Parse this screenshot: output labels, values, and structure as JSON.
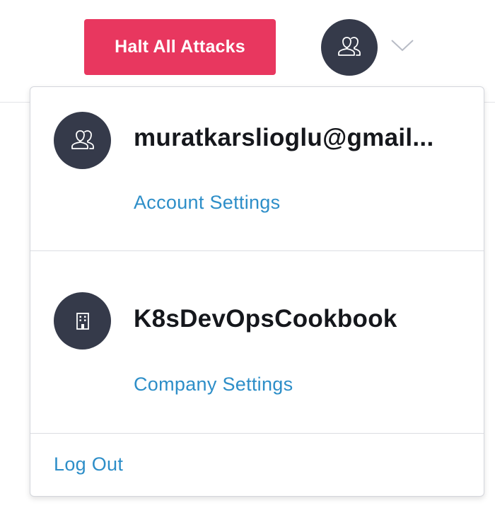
{
  "header": {
    "halt_button_label": "Halt All Attacks",
    "avatar_icon": "user-group-icon",
    "menu_toggle_icon": "chevron-down-icon"
  },
  "dropdown": {
    "account": {
      "icon": "user-group-icon",
      "name": "muratkarslioglu@gmail...",
      "settings_link": "Account Settings"
    },
    "company": {
      "icon": "building-icon",
      "name": "K8sDevOpsCookbook",
      "settings_link": "Company Settings"
    },
    "logout_label": "Log Out"
  },
  "colors": {
    "danger": "#e8375f",
    "avatar_bg": "#353a4a",
    "link": "#2d8ec8",
    "text": "#15171c"
  }
}
